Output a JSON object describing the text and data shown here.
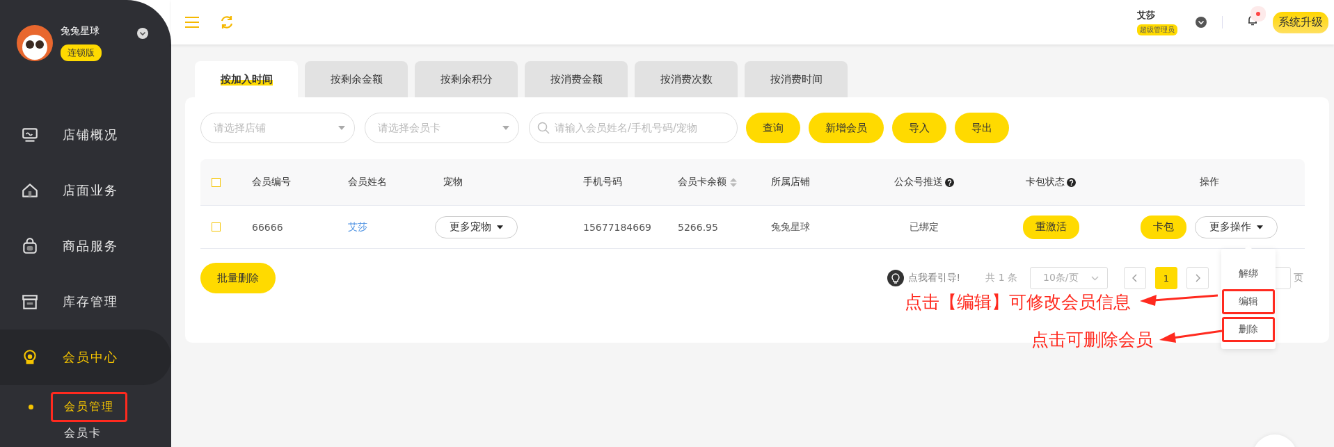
{
  "sidebar": {
    "store_name": "兔兔星球",
    "edition_badge": "连锁版",
    "menu": [
      {
        "label": "店铺概况",
        "selected": false
      },
      {
        "label": "店面业务",
        "selected": false
      },
      {
        "label": "商品服务",
        "selected": false
      },
      {
        "label": "库存管理",
        "selected": false
      },
      {
        "label": "会员中心",
        "selected": true,
        "children": [
          {
            "label": "会员管理",
            "selected": true,
            "highlighted": true
          },
          {
            "label": "会员卡",
            "selected": false,
            "highlighted": false
          }
        ]
      }
    ]
  },
  "top_bar": {
    "user_name": "艾莎",
    "role_badge": "超级管理员",
    "unread_notifications": true,
    "upgrade_button": "系统升级"
  },
  "tabs": [
    {
      "label": "按加入时间",
      "selected": true
    },
    {
      "label": "按剩余金额",
      "selected": false
    },
    {
      "label": "按剩余积分",
      "selected": false
    },
    {
      "label": "按消费金额",
      "selected": false
    },
    {
      "label": "按消费次数",
      "selected": false
    },
    {
      "label": "按消费时间",
      "selected": false
    }
  ],
  "filters": {
    "store_select": {
      "placeholder": "请选择店铺"
    },
    "card_select": {
      "placeholder": "请选择会员卡"
    },
    "search": {
      "placeholder": "请输入会员姓名/手机号码/宠物"
    }
  },
  "toolbar_buttons": [
    "查询",
    "新增会员",
    "导入",
    "导出"
  ],
  "table": {
    "header_checked": false,
    "columns": [
      {
        "label": "会员编号",
        "help": false,
        "sortable": false
      },
      {
        "label": "会员姓名",
        "help": false,
        "sortable": false
      },
      {
        "label": "宠物",
        "help": false,
        "sortable": false
      },
      {
        "label": "手机号码",
        "help": false,
        "sortable": false
      },
      {
        "label": "会员卡余额",
        "help": false,
        "sortable": true
      },
      {
        "label": "所属店铺",
        "help": false,
        "sortable": false
      },
      {
        "label": "公众号推送",
        "help": true,
        "sortable": false
      },
      {
        "label": "卡包状态",
        "help": true,
        "sortable": false
      },
      {
        "label": "操作",
        "help": false,
        "sortable": false
      }
    ],
    "rows": [
      {
        "checked": false,
        "member_id": "66666",
        "name": "艾莎",
        "pets_button": "更多宠物",
        "phone": "15677184669",
        "balance": "5266.95",
        "store": "兔兔星球",
        "wechat_push": "已绑定",
        "card_status_button": "重激活",
        "card_button": "卡包",
        "more_button": "更多操作"
      }
    ]
  },
  "batch_delete_button": "批量删除",
  "pagination": {
    "guide": "点我看引导!",
    "total": "共 1 条",
    "page_size": "10条/页",
    "pages": [
      {
        "label": "1",
        "selected": true
      }
    ],
    "jump_suffix": "页"
  },
  "action_menu": {
    "items": [
      {
        "label": "解绑",
        "highlighted": false
      },
      {
        "label": "编辑",
        "highlighted": true
      },
      {
        "label": "删除",
        "highlighted": true
      }
    ]
  },
  "annotations": [
    {
      "text": "点击【编辑】可修改会员信息"
    },
    {
      "text": "点击可删除会员"
    }
  ]
}
